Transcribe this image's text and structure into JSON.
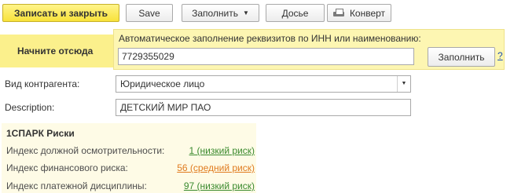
{
  "toolbar": {
    "save_close_label": "Записать и закрыть",
    "save_label": "Save",
    "fill_menu_label": "Заполнить",
    "dossier_label": "Досье",
    "envelope_label": "Конверт"
  },
  "hint": {
    "text": "Начните отсюда"
  },
  "autofill": {
    "label": "Автоматическое заполнение реквизитов по ИНН или наименованию:",
    "inn_value": "7729355029",
    "fill_button_label": "Заполнить",
    "help_label": "?"
  },
  "form": {
    "counterparty_type_label": "Вид контрагента:",
    "counterparty_type_value": "Юридическое лицо",
    "description_label": "Description:",
    "description_value": "ДЕТСКИЙ МИР ПАО"
  },
  "spark": {
    "title": "1СПАРК Риски",
    "rows": [
      {
        "label": "Индекс должной осмотрительности:",
        "value": "1 (низкий риск)",
        "color": "#3a8a2e"
      },
      {
        "label": "Индекс финансового риска:",
        "value": "56 (средний риск)",
        "color": "#e07b1f"
      },
      {
        "label": "Индекс платежной дисциплины:",
        "value": "97 (низкий риск)",
        "color": "#3a8a2e"
      }
    ]
  },
  "colors": {
    "primary_button": "#f8e23a",
    "hint_bg": "#fbf08c",
    "panel_bg": "#fdf6b2",
    "low_risk": "#3a8a2e",
    "medium_risk": "#e07b1f"
  }
}
